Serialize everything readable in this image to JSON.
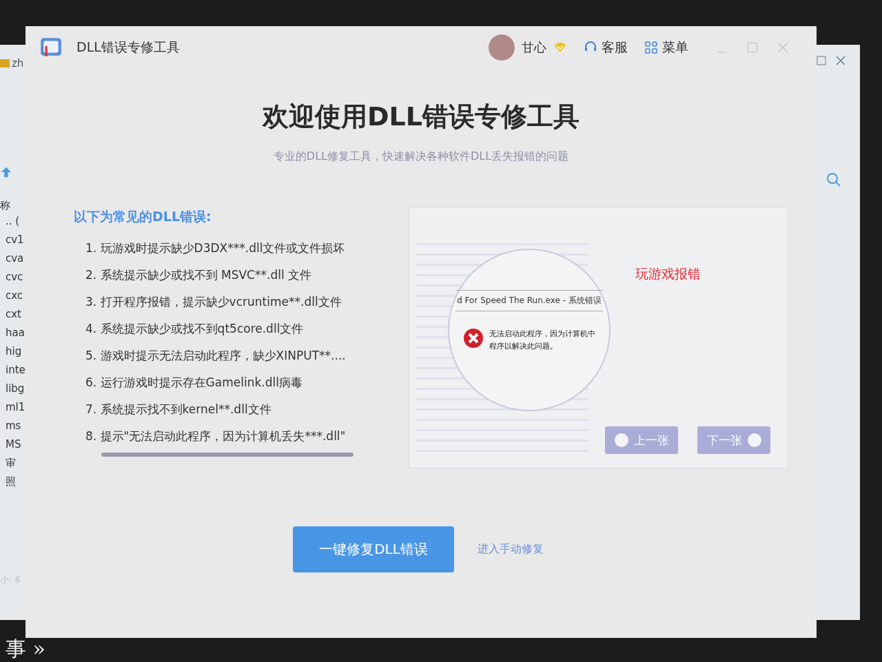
{
  "window": {
    "title": "DLL错误专修工具"
  },
  "user": {
    "name": "甘心",
    "vip": true
  },
  "header_links": [
    {
      "kind": "service",
      "label": "客服"
    },
    {
      "kind": "menu",
      "label": "菜单"
    }
  ],
  "heading": "欢迎使用DLL错误专修工具",
  "subtitle": "专业的DLL修复工具，快速解决各种软件DLL丢失报错的问题",
  "errors": {
    "title": "以下为常见的DLL错误:",
    "items": [
      "1. 玩游戏时提示缺少D3DX***.dll文件或文件损坏",
      "2. 系统提示缺少或找不到 MSVC**.dll 文件",
      "3. 打开程序报错，提示缺少vcruntime**.dll文件",
      "4. 系统提示缺少或找不到qt5core.dll文件",
      "5. 游戏时提示无法启动此程序，缺少XINPUT**....",
      "6. 运行游戏时提示存在Gamelink.dll病毒",
      "7. 系统提示找不到kernel**.dll文件",
      "8. 提示\"无法启动此程序，因为计算机丢失***.dll\""
    ]
  },
  "carousel": {
    "caption": "玩游戏报错",
    "dialog_title": "d For Speed The Run.exe - 系统错误",
    "dialog_lines": [
      "无法启动此程序，因为计算机中",
      "程序以解决此问题。"
    ],
    "prev": "上一张",
    "next": "下一张"
  },
  "actions": {
    "primary": "一键修复DLL错误",
    "link": "进入手动修复"
  },
  "background_window": {
    "title": "zh",
    "column_header": "称",
    "files": [
      ".. (",
      "cv1",
      "cva",
      "cvc",
      "cxc",
      "cxt",
      "haa",
      "hig",
      "inte",
      "libg",
      "ml1",
      "ms",
      "MS",
      "审",
      "照"
    ],
    "status": "小: 6"
  },
  "desktop": {
    "text": "事 »"
  }
}
